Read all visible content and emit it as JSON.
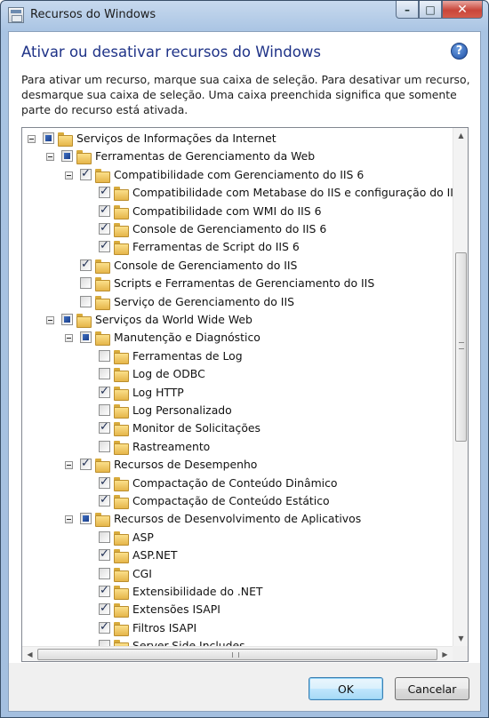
{
  "window": {
    "title": "Recursos do Windows",
    "caption": {
      "minimize": "–",
      "maximize": "□",
      "close": "✕"
    }
  },
  "header": {
    "heading": "Ativar ou desativar recursos do Windows",
    "help_icon": "?"
  },
  "description": "Para ativar um recurso, marque sua caixa de seleção. Para desativar um recurso, desmarque sua caixa de seleção. Uma caixa preenchida significa que somente parte do recurso está ativada.",
  "tree": {
    "items": [
      {
        "label": "Serviços de Informações da Internet",
        "level": 0,
        "state": "partial",
        "expandable": true
      },
      {
        "label": "Ferramentas de Gerenciamento da Web",
        "level": 1,
        "state": "partial",
        "expandable": true
      },
      {
        "label": "Compatibilidade com Gerenciamento do IIS 6",
        "level": 2,
        "state": "checked",
        "expandable": true
      },
      {
        "label": "Compatibilidade com Metabase do IIS e configuração do IIS",
        "level": 3,
        "state": "checked",
        "expandable": false
      },
      {
        "label": "Compatibilidade com WMI do IIS 6",
        "level": 3,
        "state": "checked",
        "expandable": false
      },
      {
        "label": "Console de Gerenciamento do IIS 6",
        "level": 3,
        "state": "checked",
        "expandable": false
      },
      {
        "label": "Ferramentas de Script do IIS 6",
        "level": 3,
        "state": "checked",
        "expandable": false
      },
      {
        "label": "Console de Gerenciamento do IIS",
        "level": 2,
        "state": "checked",
        "expandable": false
      },
      {
        "label": "Scripts e Ferramentas de Gerenciamento do IIS",
        "level": 2,
        "state": "unchecked",
        "expandable": false
      },
      {
        "label": "Serviço de Gerenciamento do IIS",
        "level": 2,
        "state": "unchecked",
        "expandable": false
      },
      {
        "label": "Serviços da World Wide Web",
        "level": 1,
        "state": "partial",
        "expandable": true
      },
      {
        "label": "Manutenção e Diagnóstico",
        "level": 2,
        "state": "partial",
        "expandable": true
      },
      {
        "label": "Ferramentas de Log",
        "level": 3,
        "state": "unchecked",
        "expandable": false
      },
      {
        "label": "Log de ODBC",
        "level": 3,
        "state": "unchecked",
        "expandable": false
      },
      {
        "label": "Log HTTP",
        "level": 3,
        "state": "checked",
        "expandable": false
      },
      {
        "label": "Log Personalizado",
        "level": 3,
        "state": "unchecked",
        "expandable": false
      },
      {
        "label": "Monitor de Solicitações",
        "level": 3,
        "state": "checked",
        "expandable": false
      },
      {
        "label": "Rastreamento",
        "level": 3,
        "state": "unchecked",
        "expandable": false
      },
      {
        "label": "Recursos de Desempenho",
        "level": 2,
        "state": "checked",
        "expandable": true
      },
      {
        "label": "Compactação de Conteúdo Dinâmico",
        "level": 3,
        "state": "checked",
        "expandable": false
      },
      {
        "label": "Compactação de Conteúdo Estático",
        "level": 3,
        "state": "checked",
        "expandable": false
      },
      {
        "label": "Recursos de Desenvolvimento de Aplicativos",
        "level": 2,
        "state": "partial",
        "expandable": true
      },
      {
        "label": "ASP",
        "level": 3,
        "state": "unchecked",
        "expandable": false
      },
      {
        "label": "ASP.NET",
        "level": 3,
        "state": "checked",
        "expandable": false
      },
      {
        "label": "CGI",
        "level": 3,
        "state": "unchecked",
        "expandable": false
      },
      {
        "label": "Extensibilidade do .NET",
        "level": 3,
        "state": "checked",
        "expandable": false
      },
      {
        "label": "Extensões ISAPI",
        "level": 3,
        "state": "checked",
        "expandable": false
      },
      {
        "label": "Filtros ISAPI",
        "level": 3,
        "state": "checked",
        "expandable": false
      },
      {
        "label": "Server-Side Includes",
        "level": 3,
        "state": "unchecked",
        "expandable": false
      }
    ]
  },
  "buttons": {
    "ok": "OK",
    "cancel": "Cancelar"
  },
  "colors": {
    "heading": "#1e3287",
    "partial_fill": "#1b3e8a",
    "folder": "#e5b54a"
  }
}
